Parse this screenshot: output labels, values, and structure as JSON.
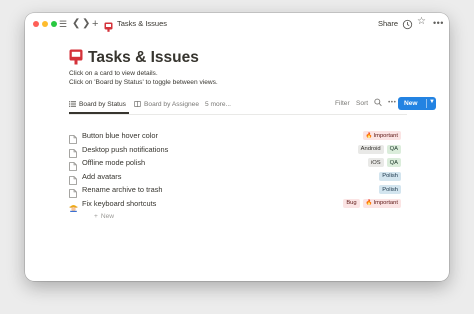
{
  "titlebar": {
    "menu_icon": "hamburger-menu-icon",
    "back_icon": "chevron-left-icon",
    "forward_icon": "chevron-right-icon",
    "new_page_icon": "plus-icon",
    "breadcrumb_icon": "red-bookmark-card-icon",
    "breadcrumb_title": "Tasks & Issues",
    "share_label": "Share",
    "updates_icon": "clock-icon",
    "favorite_icon": "star-icon",
    "more_icon": "more-horizontal-icon"
  },
  "page": {
    "icon": "red-bookmark-card-icon",
    "title": "Tasks & Issues",
    "description": [
      "Click on a card to view details.",
      "Click on 'Board by Status' to toggle between views."
    ]
  },
  "views": {
    "tabs": [
      {
        "label": "Board by Status",
        "icon": "list-icon",
        "active": true
      },
      {
        "label": "Board by Assignee",
        "icon": "board-icon",
        "active": false
      },
      {
        "label": "5 more...",
        "active": false
      }
    ],
    "filter_label": "Filter",
    "sort_label": "Sort",
    "search_icon": "search-icon",
    "more_icon": "more-horizontal-icon",
    "new_label": "New",
    "new_dropdown_icon": "chevron-down-icon"
  },
  "items": [
    {
      "title": "Button blue hover color",
      "icon": "page-icon",
      "tags": [
        {
          "label": "Important",
          "style": "important",
          "icon": "fire-icon"
        }
      ]
    },
    {
      "title": "Desktop push notifications",
      "icon": "page-icon",
      "tags": [
        {
          "label": "Android",
          "style": "gray"
        },
        {
          "label": "QA",
          "style": "qa"
        }
      ]
    },
    {
      "title": "Offline mode polish",
      "icon": "page-icon",
      "tags": [
        {
          "label": "iOS",
          "style": "gray"
        },
        {
          "label": "QA",
          "style": "qa"
        }
      ]
    },
    {
      "title": "Add avatars",
      "icon": "page-icon",
      "tags": [
        {
          "label": "Polish",
          "style": "polish"
        }
      ]
    },
    {
      "title": "Rename archive to trash",
      "icon": "page-icon",
      "tags": [
        {
          "label": "Polish",
          "style": "polish"
        }
      ]
    },
    {
      "title": "Fix keyboard shortcuts",
      "icon": "construction-worker-icon",
      "tags": [
        {
          "label": "Bug",
          "style": "bug"
        },
        {
          "label": "Important",
          "style": "important",
          "icon": "fire-icon"
        }
      ]
    }
  ],
  "new_row_label": "New",
  "help_label": "?",
  "colors": {
    "accent": "#2383e2",
    "important_bg": "#fbe4e4",
    "qa_bg": "#dbeddb",
    "polish_bg": "#d3e5ef",
    "gray_bg": "#e9e9e7"
  }
}
